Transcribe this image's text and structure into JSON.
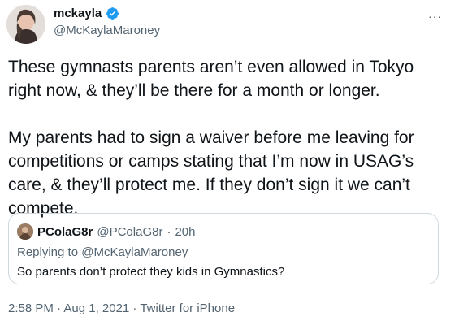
{
  "author": {
    "display_name": "mckayla",
    "handle": "@McKaylaMaroney"
  },
  "icons": {
    "verified": "verified-badge-icon",
    "more": "more-options-icon",
    "avatar": "profile-avatar",
    "quote_avatar": "quote-profile-avatar"
  },
  "colors": {
    "verified_blue": "#1d9bf0",
    "secondary_text": "#536471",
    "border": "#cfd9de"
  },
  "tweet": {
    "text": "These gymnasts parents aren’t even allowed in Tokyo right now, & they’ll be there for a month or longer.\n\nMy parents had to sign a waiver before me leaving for competitions or camps stating that I’m now in USAG’s care, & they’ll protect me. If they don’t sign it we can’t compete."
  },
  "quote": {
    "display_name": "PColaG8r",
    "handle": "@PColaG8r",
    "separator": "·",
    "time": "20h",
    "replying_prefix": "Replying to ",
    "replying_to": "@McKaylaMaroney",
    "text": "So parents don’t protect they kids in Gymnastics?"
  },
  "meta": {
    "line": "2:58 PM · Aug 1, 2021 · Twitter for iPhone"
  },
  "more_label": "···"
}
